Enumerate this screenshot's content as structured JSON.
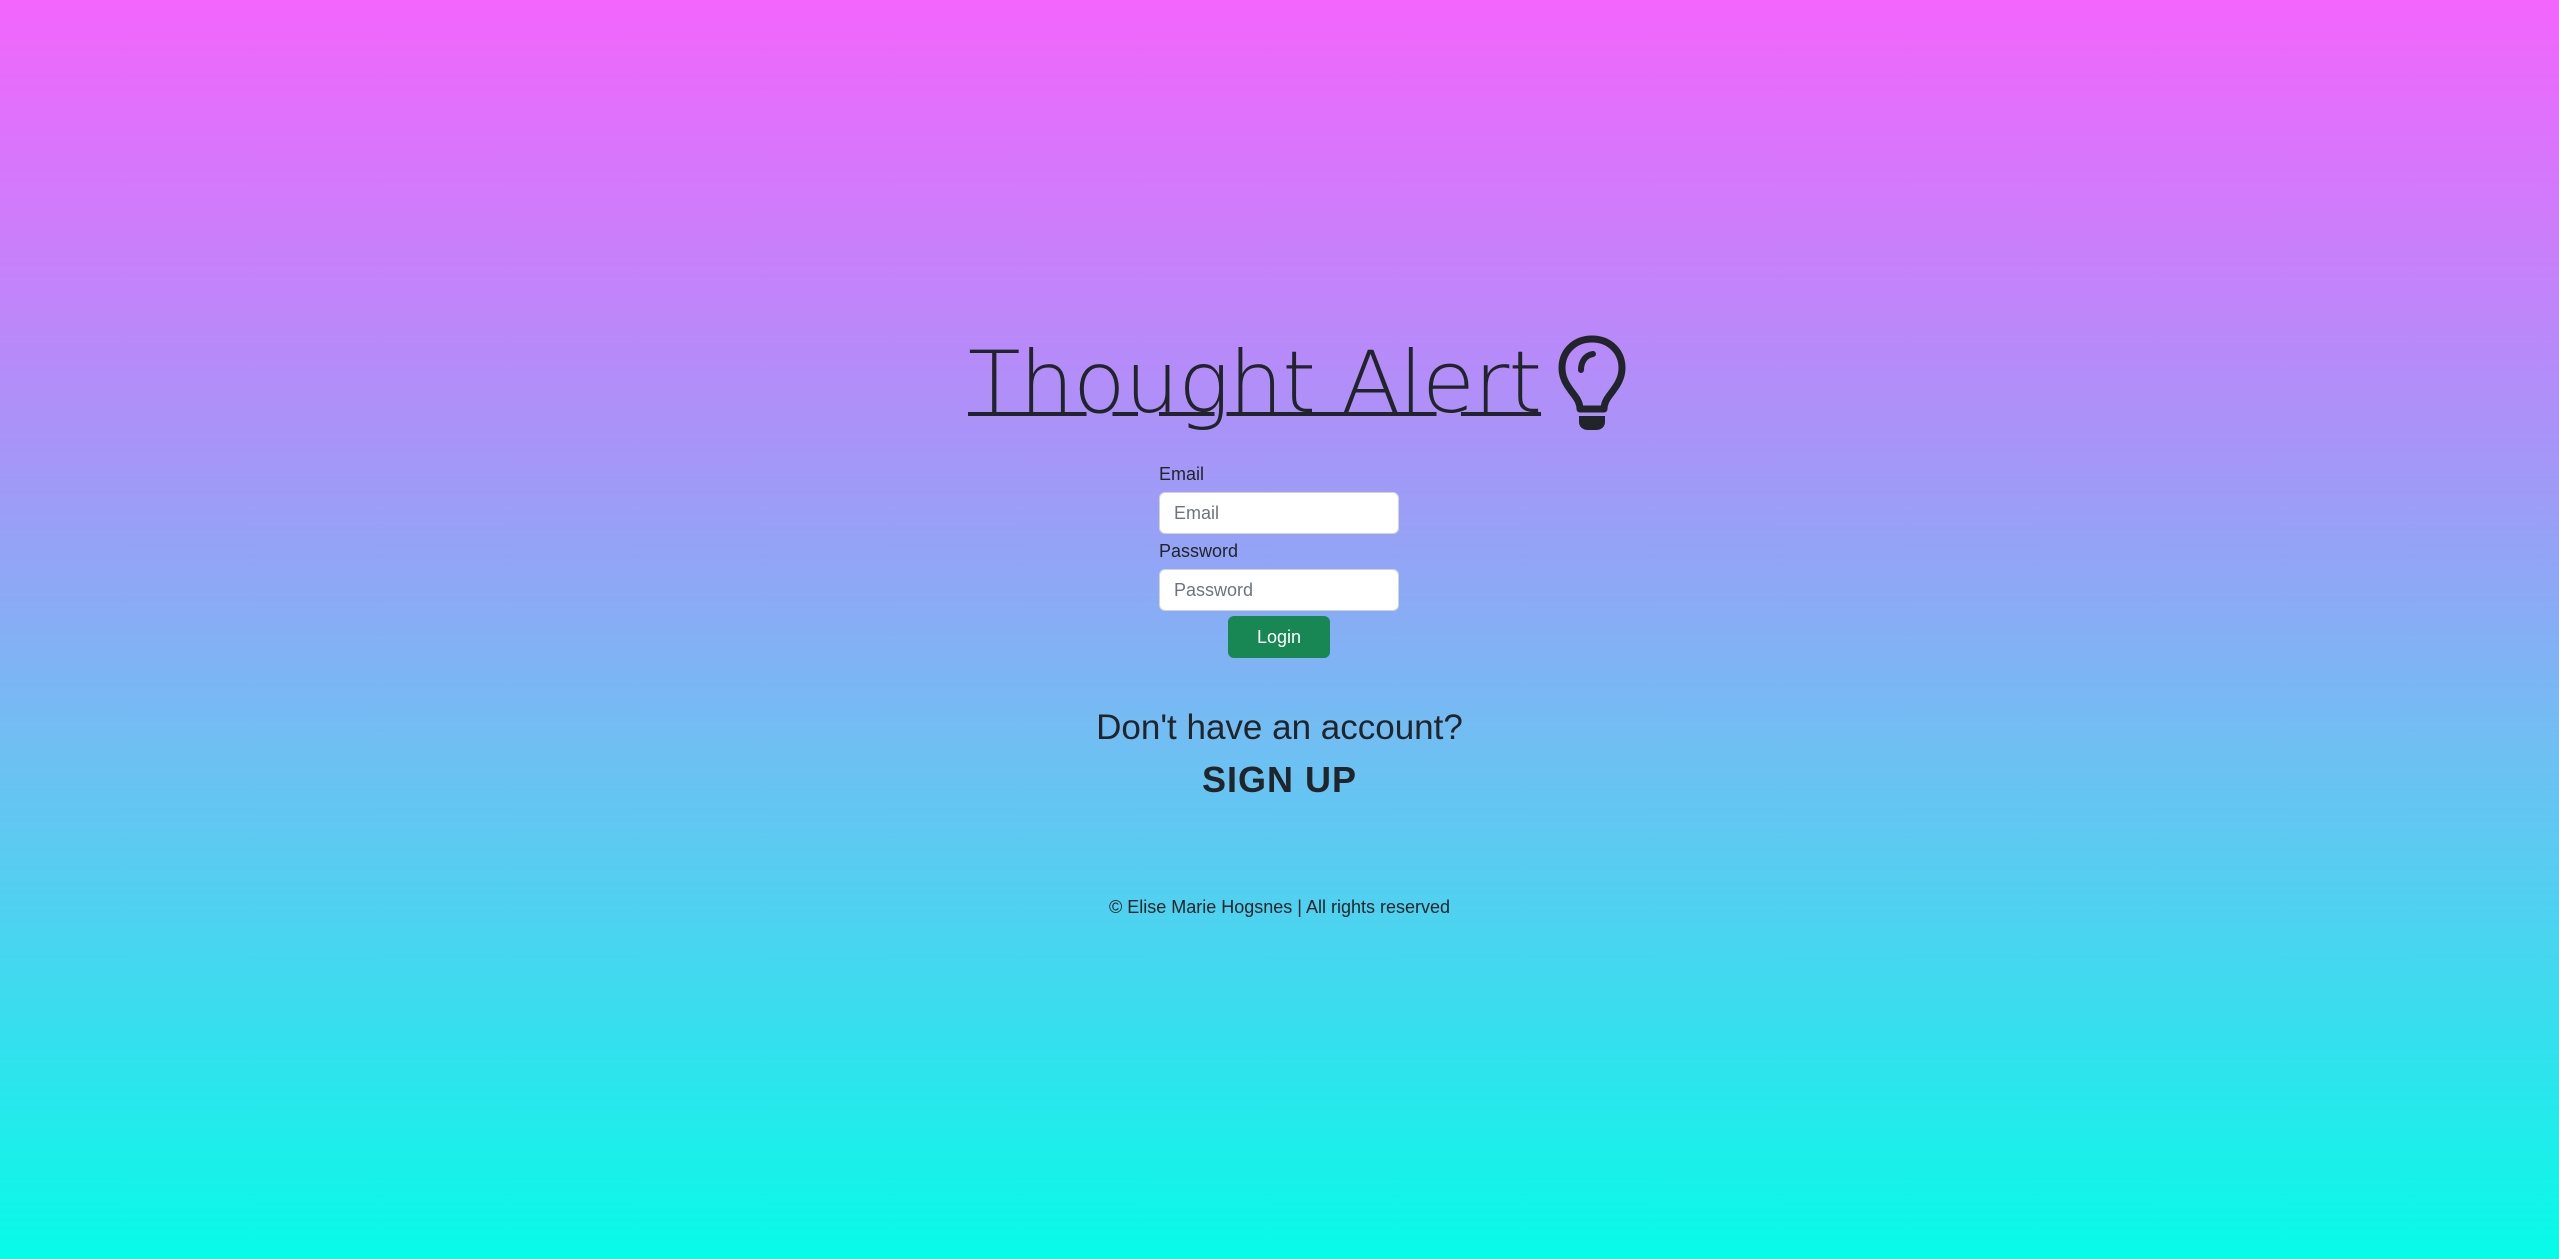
{
  "header": {
    "title": "Thought Alert",
    "icon": "lightbulb-icon"
  },
  "login_form": {
    "email_label": "Email",
    "email_placeholder": "Email",
    "email_value": "",
    "password_label": "Password",
    "password_placeholder": "Password",
    "password_value": "",
    "login_label": "Login"
  },
  "signup": {
    "prompt": "Don't have an account?",
    "link_label": "SIGN UP"
  },
  "footer": {
    "text": "© Elise Marie Hogsnes | All rights reserved"
  },
  "colors": {
    "gradient_top": "#f365fd",
    "gradient_bottom": "#07fbe8",
    "login_button": "#198754",
    "text": "#212529"
  }
}
